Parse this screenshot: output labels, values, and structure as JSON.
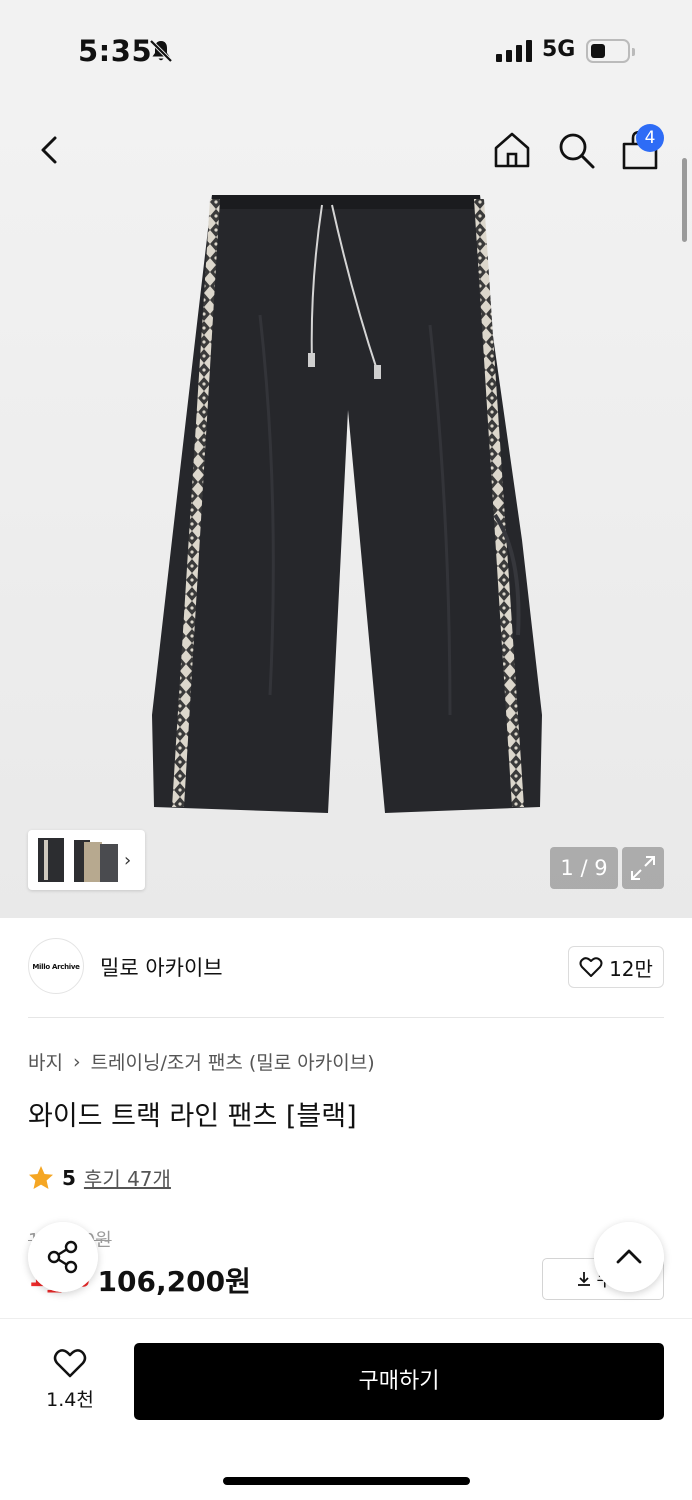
{
  "status_bar": {
    "time": "5:35",
    "network": "5G",
    "signal_bars": 4
  },
  "header": {
    "cart_count": "4"
  },
  "gallery": {
    "counter": "1 / 9",
    "thumb_arrow": "›"
  },
  "brand": {
    "logo_text": "Millo Archive",
    "name": "밀로 아카이브",
    "likes": "12만"
  },
  "breadcrumb": {
    "category": "바지",
    "separator": "›",
    "subcategory": "트레이닝/조거 팬츠 (밀로 아카이브)"
  },
  "product": {
    "title": "와이드 트랙 라인 팬츠 [블랙]",
    "rating": "5",
    "reviews": "후기 47개",
    "original_price": "1__,_00원",
    "discount": "1_%",
    "sale_price": "106,200원",
    "coupon_label": "쿠폰"
  },
  "bottom_bar": {
    "wish_count": "1.4천",
    "buy_label": "구매하기"
  },
  "colors": {
    "accent_badge": "#2e6cf6",
    "discount": "#f02a2a",
    "star": "#f5a623"
  }
}
